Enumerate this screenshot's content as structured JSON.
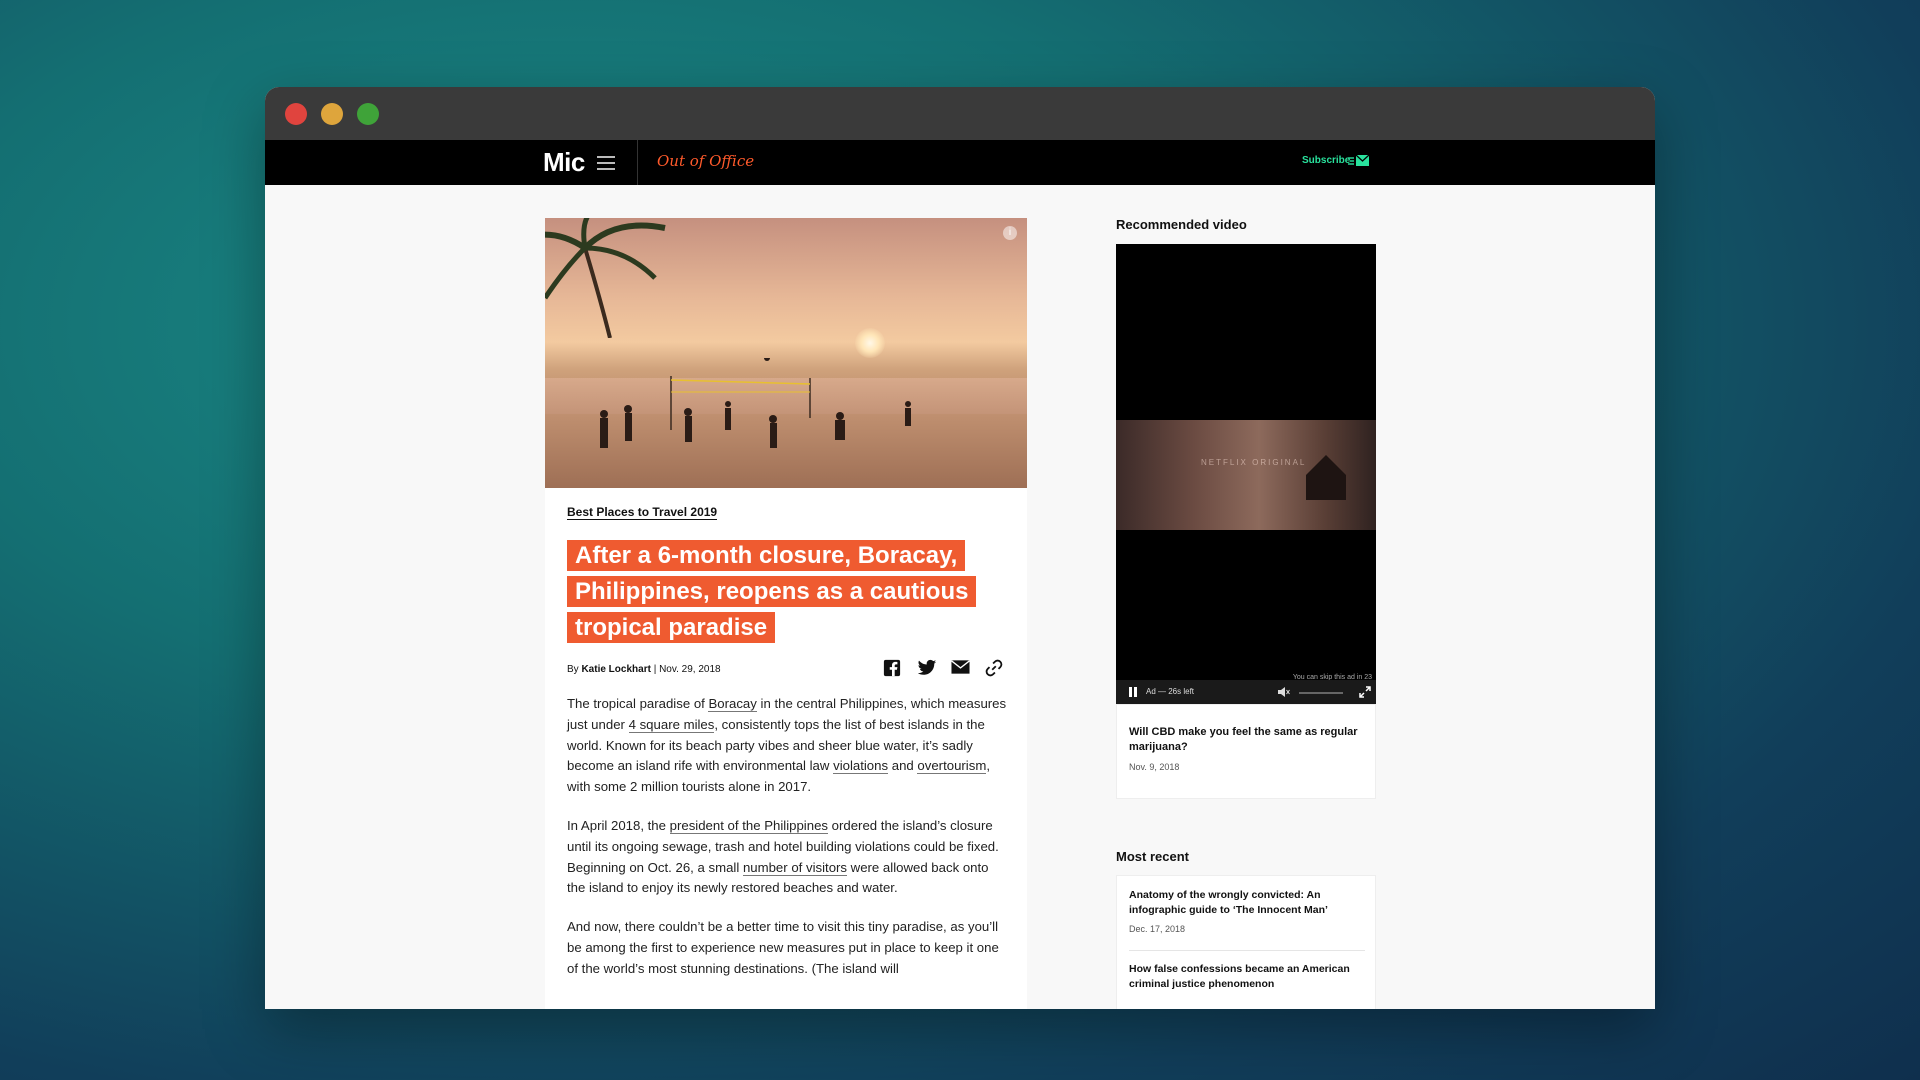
{
  "nav": {
    "logo": "Mic",
    "section_logo": "Out of Office",
    "subscribe": "Subscribe"
  },
  "article": {
    "kicker": "Best Places to Travel 2019",
    "headline_lines": [
      "After a 6-month closure, Boracay,",
      "Philippines, reopens as a cautious",
      "tropical paradise"
    ],
    "byline_prefix": "By ",
    "author": "Katie Lockhart",
    "date": " | Nov. 29, 2018",
    "p1": {
      "a": "The tropical paradise of ",
      "l1": "Boracay",
      "b": " in the central Philippines, which measures just under ",
      "l2": "4 square miles",
      "c": ", consistently tops the list of best islands in the world. Known for its beach party vibes and sheer blue water, it’s sadly become an island rife with environmental law ",
      "l3": "violations",
      "d": " and ",
      "l4": "overtourism",
      "e": ", with some 2 million tourists alone in 2017."
    },
    "p2": {
      "a": "In April 2018, the ",
      "l1": "president of the Philippines",
      "b": " ordered the island’s closure until its ongoing sewage, trash and hotel building violations could be fixed. Beginning on Oct. 26, a small ",
      "l2": "number of visitors",
      "c": " were allowed back onto the island to enjoy its newly restored beaches and water."
    },
    "p3": "And now, there couldn’t be a better time to visit this tiny paradise, as you’ll be among the first to experience new measures put in place to keep it one of the world’s most stunning destinations. (The island will"
  },
  "sidebar": {
    "recommended_title": "Recommended video",
    "video": {
      "frame_label": "NETFLIX ORIGINAL",
      "skip_text": "You can skip this ad in 23",
      "ad_text": "Ad — 26s left"
    },
    "recommended_item": {
      "title": "Will CBD make you feel the same as regular marijuana?",
      "date": "Nov. 9, 2018"
    },
    "most_recent_title": "Most recent",
    "most_recent": [
      {
        "title": "Anatomy of the wrongly convicted: An infographic guide to ‘The Innocent Man’",
        "date": "Dec. 17, 2018"
      },
      {
        "title": "How false confessions became an American criminal justice phenomenon",
        "date": ""
      }
    ]
  },
  "colors": {
    "accent_orange": "#ef5b30",
    "subscribe_green": "#29e29d",
    "navbar": "#000000"
  }
}
